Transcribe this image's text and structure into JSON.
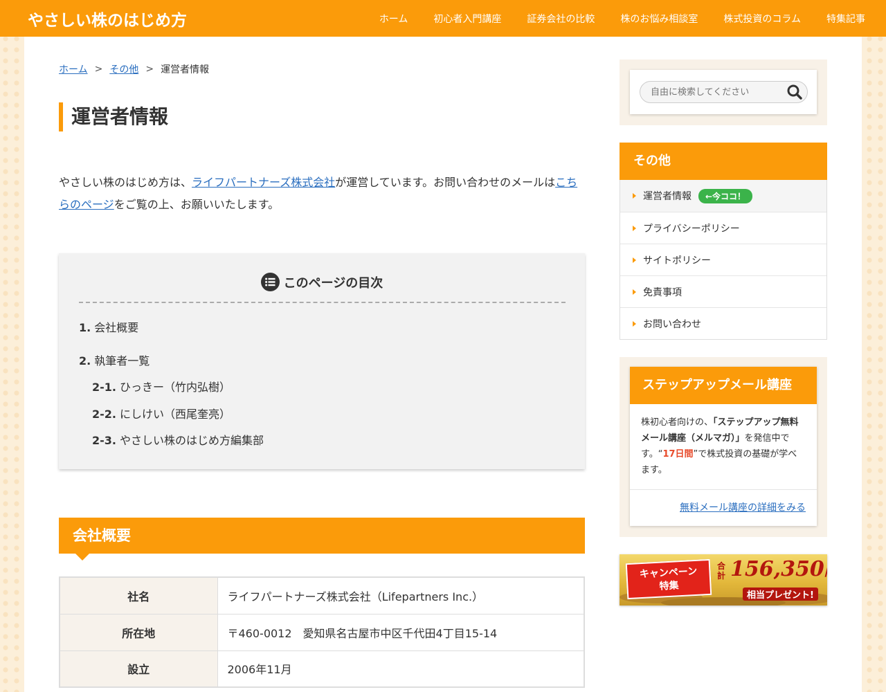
{
  "header": {
    "logo": "やさしい株のはじめ方",
    "nav": [
      "ホーム",
      "初心者入門講座",
      "証券会社の比較",
      "株のお悩み相談室",
      "株式投資のコラム",
      "特集記事"
    ]
  },
  "breadcrumb": {
    "home": "ホーム",
    "category": "その他",
    "current": "運営者情報",
    "separator": ">"
  },
  "page_title": "運営者情報",
  "intro": {
    "text1": "やさしい株のはじめ方は、",
    "link1": "ライフパートナーズ株式会社",
    "text2": "が運営しています。お問い合わせのメールは",
    "link2": "こちらのページ",
    "text3": "をご覧の上、お願いいたします。"
  },
  "toc": {
    "title": "このページの目次",
    "items": [
      {
        "num": "1.",
        "label": "会社概要"
      },
      {
        "num": "2.",
        "label": "執筆者一覧"
      },
      {
        "num": "2-1.",
        "label": "ひっきー（竹内弘樹）"
      },
      {
        "num": "2-2.",
        "label": "にしけい（西尾奎亮）"
      },
      {
        "num": "2-3.",
        "label": "やさしい株のはじめ方編集部"
      }
    ]
  },
  "company_section": {
    "title": "会社概要",
    "rows": [
      {
        "label": "社名",
        "value": "ライフパートナーズ株式会社（Lifepartners Inc.）"
      },
      {
        "label": "所在地",
        "value": "〒460-0012　愛知県名古屋市中区千代田4丁目15-14"
      },
      {
        "label": "設立",
        "value": "2006年11月"
      }
    ]
  },
  "sidebar": {
    "search": {
      "placeholder": "自由に検索してください"
    },
    "category": {
      "title": "その他",
      "now_badge": "←今ココ！",
      "items": [
        "運営者情報",
        "プライバシーポリシー",
        "サイトポリシー",
        "免責事項",
        "お問い合わせ"
      ]
    },
    "mail": {
      "title": "ステップアップメール講座",
      "t1": "株初心者向けの、",
      "b1": "「ステップアップ無料メール講座（メルマガ）」",
      "t2": "を発信中です。“",
      "red": "17日間",
      "t3": "”で株式投資の基礎が学べます。",
      "link": "無料メール講座の詳細をみる"
    },
    "banner": {
      "ribbon_line1": "キャンペーン",
      "ribbon_line2": "特集",
      "total_label": "合計",
      "amount": "156,350",
      "yen": "円",
      "sub": "相当プレゼント!"
    }
  },
  "colors": {
    "accent": "#fb9b0a",
    "link": "#2a6ebf",
    "badge": "#3bb34a",
    "highlight": "#e84a2a"
  }
}
